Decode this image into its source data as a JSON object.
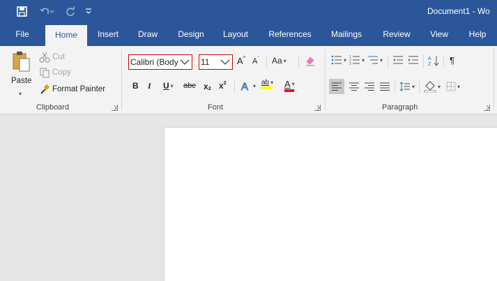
{
  "window": {
    "title": "Document1 - Wo"
  },
  "tabs": [
    {
      "label": "File"
    },
    {
      "label": "Home"
    },
    {
      "label": "Insert"
    },
    {
      "label": "Draw"
    },
    {
      "label": "Design"
    },
    {
      "label": "Layout"
    },
    {
      "label": "References"
    },
    {
      "label": "Mailings"
    },
    {
      "label": "Review"
    },
    {
      "label": "View"
    },
    {
      "label": "Help"
    }
  ],
  "clipboard": {
    "paste_label": "Paste",
    "cut_label": "Cut",
    "copy_label": "Copy",
    "format_painter_label": "Format Painter",
    "group_label": "Clipboard"
  },
  "font": {
    "font_name": "Calibri (Body",
    "font_size": "11",
    "grow_label": "A",
    "shrink_label": "A",
    "case_label": "Aa",
    "bold_label": "B",
    "italic_label": "I",
    "underline_label": "U",
    "strike_label": "abc",
    "subscript_label": "x",
    "superscript_label": "x",
    "subscript_mark": "2",
    "superscript_mark": "2",
    "highlight_label": "ab",
    "font_color_label": "A",
    "group_label": "Font"
  },
  "paragraph": {
    "group_label": "Paragraph",
    "pilcrow_label": "¶",
    "sort_label": "A↓"
  },
  "colors": {
    "title_bar": "#2b579a",
    "ribbon": "#f3f3f3",
    "doc_background": "#e6e6e6",
    "highlight_yellow": "#ffff00",
    "font_color_red": "#e81123",
    "combo_border": "#cc0000"
  }
}
